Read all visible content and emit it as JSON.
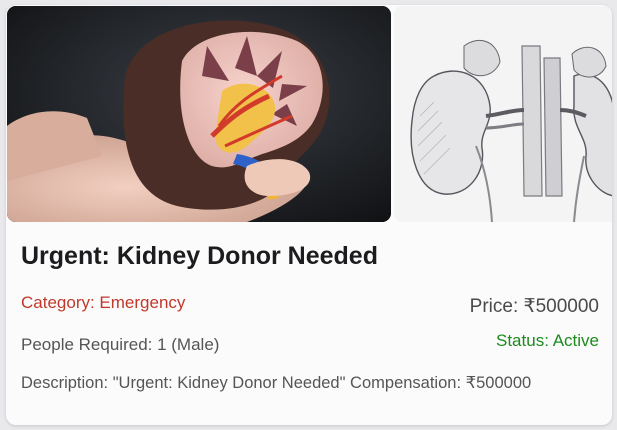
{
  "listing": {
    "title": "Urgent: Kidney Donor Needed",
    "category": "Category: Emergency",
    "price": "Price: ₹500000",
    "people_required": "People Required: 1 (Male)",
    "status": "Status: Active",
    "description": "Description: \"Urgent: Kidney Donor Needed\" Compensation: ₹500000"
  },
  "images": [
    {
      "name": "kidney-model-photo"
    },
    {
      "name": "kidney-anatomy-illustration"
    }
  ],
  "colors": {
    "category": "#c0392b",
    "status": "#1d8a1d",
    "title": "#1c1c1e",
    "muted_text": "#555555",
    "card_bg": "#fbfbfc"
  }
}
